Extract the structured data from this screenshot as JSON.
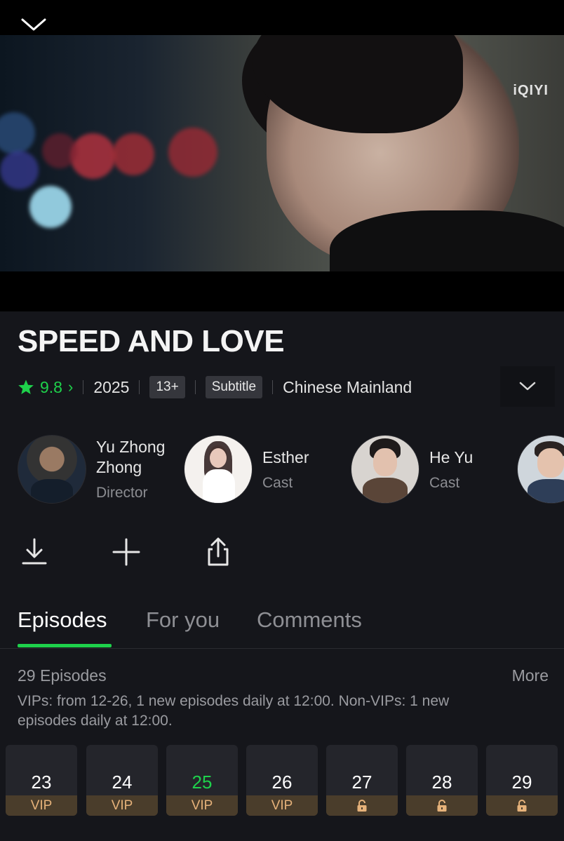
{
  "header": {
    "close_icon": "chevron-down-icon"
  },
  "hero": {
    "logo": "iQIYI"
  },
  "show": {
    "title": "SPEED AND LOVE",
    "rating": "9.8",
    "year": "2025",
    "age_rating": "13+",
    "subtitle_badge": "Subtitle",
    "region": "Chinese Mainland"
  },
  "people": [
    {
      "name": "Yu Zhong\nZhong",
      "role": "Director"
    },
    {
      "name": "Esther",
      "role": "Cast"
    },
    {
      "name": "He Yu",
      "role": "Cast"
    }
  ],
  "tabs": {
    "episodes": "Episodes",
    "for_you": "For you",
    "comments": "Comments"
  },
  "episodes_section": {
    "count_label": "29 Episodes",
    "more_label": "More",
    "schedule": "VIPs: from 12-26, 1 new episodes daily at 12:00. Non-VIPs: 1 new episodes daily at 12:00.",
    "items": [
      {
        "number": "23",
        "tag": "VIP"
      },
      {
        "number": "24",
        "tag": "VIP"
      },
      {
        "number": "25",
        "tag": "VIP",
        "current": true
      },
      {
        "number": "26",
        "tag": "VIP"
      },
      {
        "number": "27",
        "tag": "unlock-icon"
      },
      {
        "number": "28",
        "tag": "unlock-icon"
      },
      {
        "number": "29",
        "tag": "unlock-icon"
      }
    ]
  },
  "colors": {
    "accent": "#1ed14b",
    "vip_text": "#e6b27a",
    "vip_bg": "#4a3d2b",
    "background": "#15161b"
  }
}
